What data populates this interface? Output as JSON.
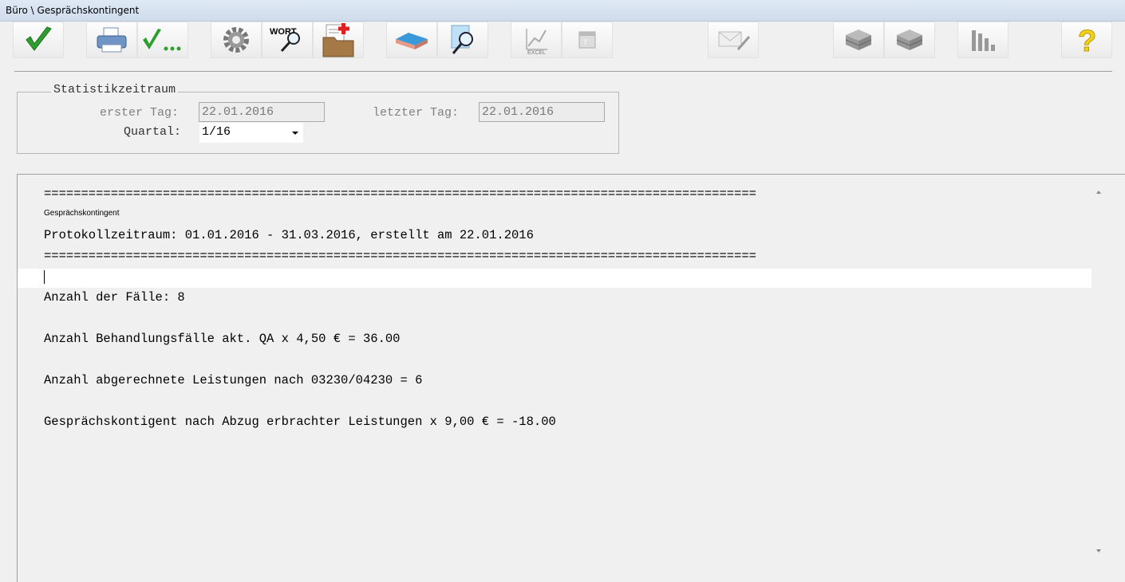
{
  "window": {
    "title": "Büro \\ Gesprächskontingent"
  },
  "toolbar": {
    "buttons": [
      {
        "name": "ok-button",
        "icon": "checkmark-icon"
      },
      {
        "name": "print-button",
        "icon": "printer-icon"
      },
      {
        "name": "check-more-button",
        "icon": "checkmark-ellipsis-icon"
      },
      {
        "name": "settings-button",
        "icon": "gear-icon"
      },
      {
        "name": "word-search-button",
        "icon": "word-magnifier-icon"
      },
      {
        "name": "patient-folder-button",
        "icon": "medical-folder-icon"
      },
      {
        "name": "eraser-button",
        "icon": "eraser-icon"
      },
      {
        "name": "document-search-button",
        "icon": "document-magnifier-icon"
      },
      {
        "name": "excel-export-button",
        "icon": "excel-chart-icon"
      },
      {
        "name": "calendar-button",
        "icon": "calendar-icon"
      },
      {
        "name": "mail-button",
        "icon": "envelope-pen-icon"
      },
      {
        "name": "tray-1-button",
        "icon": "drawer-icon"
      },
      {
        "name": "tray-2-button",
        "icon": "drawer-icon"
      },
      {
        "name": "statistics-button",
        "icon": "bar-chart-icon"
      },
      {
        "name": "help-button",
        "icon": "question-mark-icon"
      }
    ]
  },
  "period_group": {
    "legend": "Statistikzeitraum",
    "first_day_label": "erster Tag:",
    "first_day_value": "22.01.2016",
    "last_day_label": "letzter Tag:",
    "last_day_value": "22.01.2016",
    "quarter_label": "Quartal:",
    "quarter_value": "1/16"
  },
  "report": {
    "separator": "================================================================================================",
    "heading": "Gesprächskontingent",
    "period_line": "Protokollzeitraum: 01.01.2016 - 31.03.2016, erstellt am 22.01.2016",
    "line_cases": "Anzahl der Fälle: 8",
    "line_treatment": "Anzahl Behandlungsfälle akt. QA x 4,50 € = 36.00",
    "line_services": "Anzahl abgerechnete Leistungen nach 03230/04230 = 6",
    "line_remaining": "Gesprächskontigent nach Abzug erbrachter Leistungen x 9,00 € = -18.00"
  }
}
